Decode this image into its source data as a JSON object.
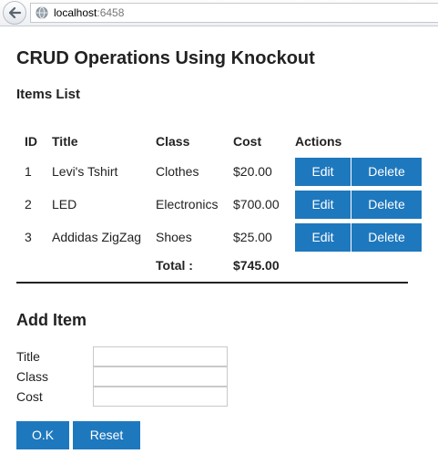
{
  "browser": {
    "url_host": "localhost",
    "url_port": ":6458"
  },
  "page": {
    "title": "CRUD Operations Using Knockout",
    "items_heading": "Items List"
  },
  "table": {
    "headers": [
      "ID",
      "Title",
      "Class",
      "Cost",
      "Actions"
    ],
    "rows": [
      {
        "id": "1",
        "title": "Levi's Tshirt",
        "class": "Clothes",
        "cost": "$20.00"
      },
      {
        "id": "2",
        "title": "LED",
        "class": "Electronics",
        "cost": "$700.00"
      },
      {
        "id": "3",
        "title": "Addidas ZigZag",
        "class": "Shoes",
        "cost": "$25.00"
      }
    ],
    "edit_label": "Edit",
    "delete_label": "Delete",
    "total_label": "Total :",
    "total_value": "$745.00"
  },
  "form": {
    "heading": "Add Item",
    "title_label": "Title",
    "class_label": "Class",
    "cost_label": "Cost",
    "title_value": "",
    "class_value": "",
    "cost_value": "",
    "ok_label": "O.K",
    "reset_label": "Reset"
  },
  "colors": {
    "button": "#1e78be"
  }
}
